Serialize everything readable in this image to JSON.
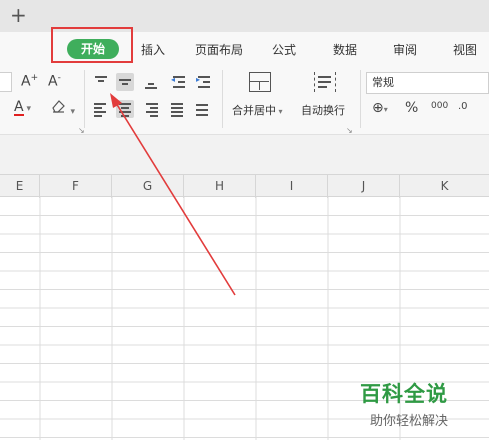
{
  "top": {
    "new_tab_icon": "plus-icon"
  },
  "ribbon": {
    "tabs": [
      {
        "label": "开始",
        "active": true
      },
      {
        "label": "插入"
      },
      {
        "label": "页面布局"
      },
      {
        "label": "公式"
      },
      {
        "label": "数据"
      },
      {
        "label": "审阅"
      },
      {
        "label": "视图"
      }
    ],
    "font": {
      "increase_size": "A",
      "decrease_size": "A",
      "font_color": "A",
      "font_color_value": "#e02020"
    },
    "merge_center_label": "合并居中",
    "wrap_text_label": "自动换行",
    "number_format_value": "常规",
    "percent_label": "%",
    "thousands_label": "000",
    "decimal_label": ".0"
  },
  "sheet": {
    "columns": [
      "E",
      "F",
      "G",
      "H",
      "I",
      "J",
      "K"
    ]
  },
  "watermark": {
    "main": "百科全说",
    "sub": "助你轻松解决"
  },
  "colors": {
    "active_tab": "#3fae5c",
    "annotation": "#e23c3c",
    "watermark": "#2f9a44"
  }
}
